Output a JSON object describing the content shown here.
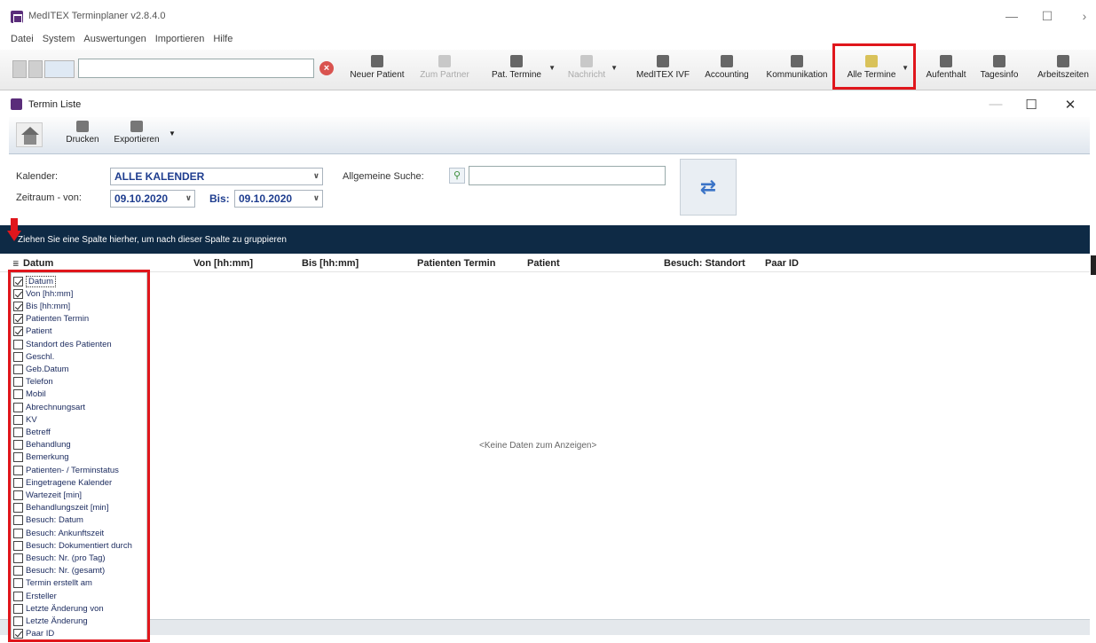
{
  "app": {
    "title": "MedITEX Terminplaner v2.8.4.0"
  },
  "menu": [
    "Datei",
    "System",
    "Auswertungen",
    "Importieren",
    "Hilfe"
  ],
  "toolbar": {
    "buttons": [
      {
        "label": "Neuer Patient",
        "icon": "new-patient-icon",
        "enabled": true
      },
      {
        "label": "Zum Partner",
        "icon": "partner-icon",
        "enabled": false
      },
      {
        "label": "Pat. Termine",
        "icon": "patient-appointments-icon",
        "enabled": true
      },
      {
        "label": "Nachricht",
        "icon": "message-icon",
        "enabled": false
      },
      {
        "label": "MedITEX IVF",
        "icon": "meditex-ivf-icon",
        "enabled": true
      },
      {
        "label": "Accounting",
        "icon": "accounting-icon",
        "enabled": true
      },
      {
        "label": "Kommunikation",
        "icon": "communication-icon",
        "enabled": true
      },
      {
        "label": "Alle Termine",
        "icon": "all-appointments-icon",
        "enabled": true
      },
      {
        "label": "Aufenthalt",
        "icon": "stay-icon",
        "enabled": true
      },
      {
        "label": "Tagesinfo",
        "icon": "day-info-icon",
        "enabled": true
      },
      {
        "label": "Arbeitszeiten",
        "icon": "working-hours-icon",
        "enabled": true
      }
    ]
  },
  "child": {
    "title": "Termin Liste",
    "ribbon": {
      "print_label": "Drucken",
      "export_label": "Exportieren"
    }
  },
  "filter": {
    "calendar_label": "Kalender:",
    "calendar_value": "ALLE KALENDER",
    "range_from_label": "Zeitraum - von:",
    "range_from_value": "09.10.2020",
    "range_to_label": "Bis:",
    "range_to_value": "09.10.2020",
    "search_label": "Allgemeine Suche:",
    "search_value": ""
  },
  "grid": {
    "group_hint": "Ziehen Sie eine Spalte hierher, um nach dieser Spalte zu gruppieren",
    "columns": [
      "Datum",
      "Von [hh:mm]",
      "Bis [hh:mm]",
      "Patienten Termin",
      "Patient",
      "Besuch: Standort",
      "Paar ID"
    ],
    "empty_text": "<Keine Daten zum Anzeigen>"
  },
  "column_chooser": [
    {
      "label": "Datum",
      "checked": true
    },
    {
      "label": "Von [hh:mm]",
      "checked": true
    },
    {
      "label": "Bis [hh:mm]",
      "checked": true
    },
    {
      "label": "Patienten Termin",
      "checked": true
    },
    {
      "label": "Patient",
      "checked": true
    },
    {
      "label": "Standort des Patienten",
      "checked": false
    },
    {
      "label": "Geschl.",
      "checked": false
    },
    {
      "label": "Geb.Datum",
      "checked": false
    },
    {
      "label": "Telefon",
      "checked": false
    },
    {
      "label": "Mobil",
      "checked": false
    },
    {
      "label": "Abrechnungsart",
      "checked": false
    },
    {
      "label": "KV",
      "checked": false
    },
    {
      "label": "Betreff",
      "checked": false
    },
    {
      "label": "Behandlung",
      "checked": false
    },
    {
      "label": "Bemerkung",
      "checked": false
    },
    {
      "label": "Patienten- / Terminstatus",
      "checked": false
    },
    {
      "label": "Eingetragene Kalender",
      "checked": false
    },
    {
      "label": "Wartezeit [min]",
      "checked": false
    },
    {
      "label": "Behandlungszeit [min]",
      "checked": false
    },
    {
      "label": "Besuch: Datum",
      "checked": false
    },
    {
      "label": "Besuch: Ankunftszeit",
      "checked": false
    },
    {
      "label": "Besuch: Dokumentiert durch",
      "checked": false
    },
    {
      "label": "Besuch: Nr. (pro Tag)",
      "checked": false
    },
    {
      "label": "Besuch: Nr. (gesamt)",
      "checked": false
    },
    {
      "label": "Termin erstellt am",
      "checked": false
    },
    {
      "label": "Ersteller",
      "checked": false
    },
    {
      "label": "Letzte Änderung von",
      "checked": false
    },
    {
      "label": "Letzte Änderung",
      "checked": false
    },
    {
      "label": "Paar ID",
      "checked": true
    }
  ],
  "colors": {
    "highlight": "#e0161c",
    "group_band": "#0e2a45",
    "combo_text": "#1e3d8f"
  }
}
